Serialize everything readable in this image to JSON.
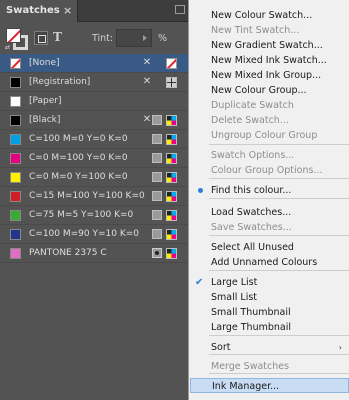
{
  "panel": {
    "tab_title": "Swatches",
    "close_glyph": "×",
    "tint_label": "Tint:",
    "tint_value": "",
    "tint_unit": "%",
    "text_glyph": "T",
    "fill_stroke_small": "⇄",
    "swatches": [
      {
        "name": "[None]",
        "color": "#ffffff",
        "chip": "none",
        "selected": true
      },
      {
        "name": "[Registration]",
        "color": "#000000",
        "chip": "solid",
        "selected": false
      },
      {
        "name": "[Paper]",
        "color": "#ffffff",
        "chip": "solid",
        "selected": false
      },
      {
        "name": "[Black]",
        "color": "#000000",
        "chip": "solid",
        "selected": false
      },
      {
        "name": "C=100 M=0 Y=0 K=0",
        "color": "#00a0e3",
        "chip": "solid",
        "selected": false
      },
      {
        "name": "C=0 M=100 Y=0 K=0",
        "color": "#e4007f",
        "chip": "solid",
        "selected": false
      },
      {
        "name": "C=0 M=0 Y=100 K=0",
        "color": "#fff100",
        "chip": "solid",
        "selected": false
      },
      {
        "name": "C=15 M=100 Y=100 K=0",
        "color": "#cf1f25",
        "chip": "solid",
        "selected": false
      },
      {
        "name": "C=75 M=5 Y=100 K=0",
        "color": "#3aa935",
        "chip": "solid",
        "selected": false
      },
      {
        "name": "C=100 M=90 Y=10 K=0",
        "color": "#23358c",
        "chip": "solid",
        "selected": false
      },
      {
        "name": "PANTONE 2375 C",
        "color": "#e06fc4",
        "chip": "solid",
        "selected": false
      }
    ]
  },
  "menu": {
    "items": [
      {
        "label": "New Colour Swatch...",
        "disabled": false
      },
      {
        "label": "New Tint Swatch...",
        "disabled": true
      },
      {
        "label": "New Gradient Swatch...",
        "disabled": false
      },
      {
        "label": "New Mixed Ink Swatch...",
        "disabled": false
      },
      {
        "label": "New Mixed Ink Group...",
        "disabled": false
      },
      {
        "label": "New Colour Group...",
        "disabled": false
      },
      {
        "label": "Duplicate Swatch",
        "disabled": true
      },
      {
        "label": "Delete Swatch...",
        "disabled": true
      },
      {
        "label": "Ungroup Colour Group",
        "disabled": true
      },
      {
        "label": "Swatch Options...",
        "disabled": true
      },
      {
        "label": "Colour Group Options...",
        "disabled": true
      },
      {
        "label": "Find this colour...",
        "disabled": false
      },
      {
        "label": "Load Swatches...",
        "disabled": false
      },
      {
        "label": "Save Swatches...",
        "disabled": true
      },
      {
        "label": "Select All Unused",
        "disabled": false
      },
      {
        "label": "Add Unnamed Colours",
        "disabled": false
      },
      {
        "label": "Large List",
        "disabled": false,
        "checked": true
      },
      {
        "label": "Small List",
        "disabled": false
      },
      {
        "label": "Small Thumbnail",
        "disabled": false
      },
      {
        "label": "Large Thumbnail",
        "disabled": false
      },
      {
        "label": "Sort",
        "disabled": false,
        "submenu": true
      },
      {
        "label": "Merge Swatches",
        "disabled": true
      },
      {
        "label": "Ink Manager...",
        "disabled": false,
        "highlighted": true
      }
    ],
    "check_glyph": "✔",
    "submenu_glyph": "›"
  }
}
